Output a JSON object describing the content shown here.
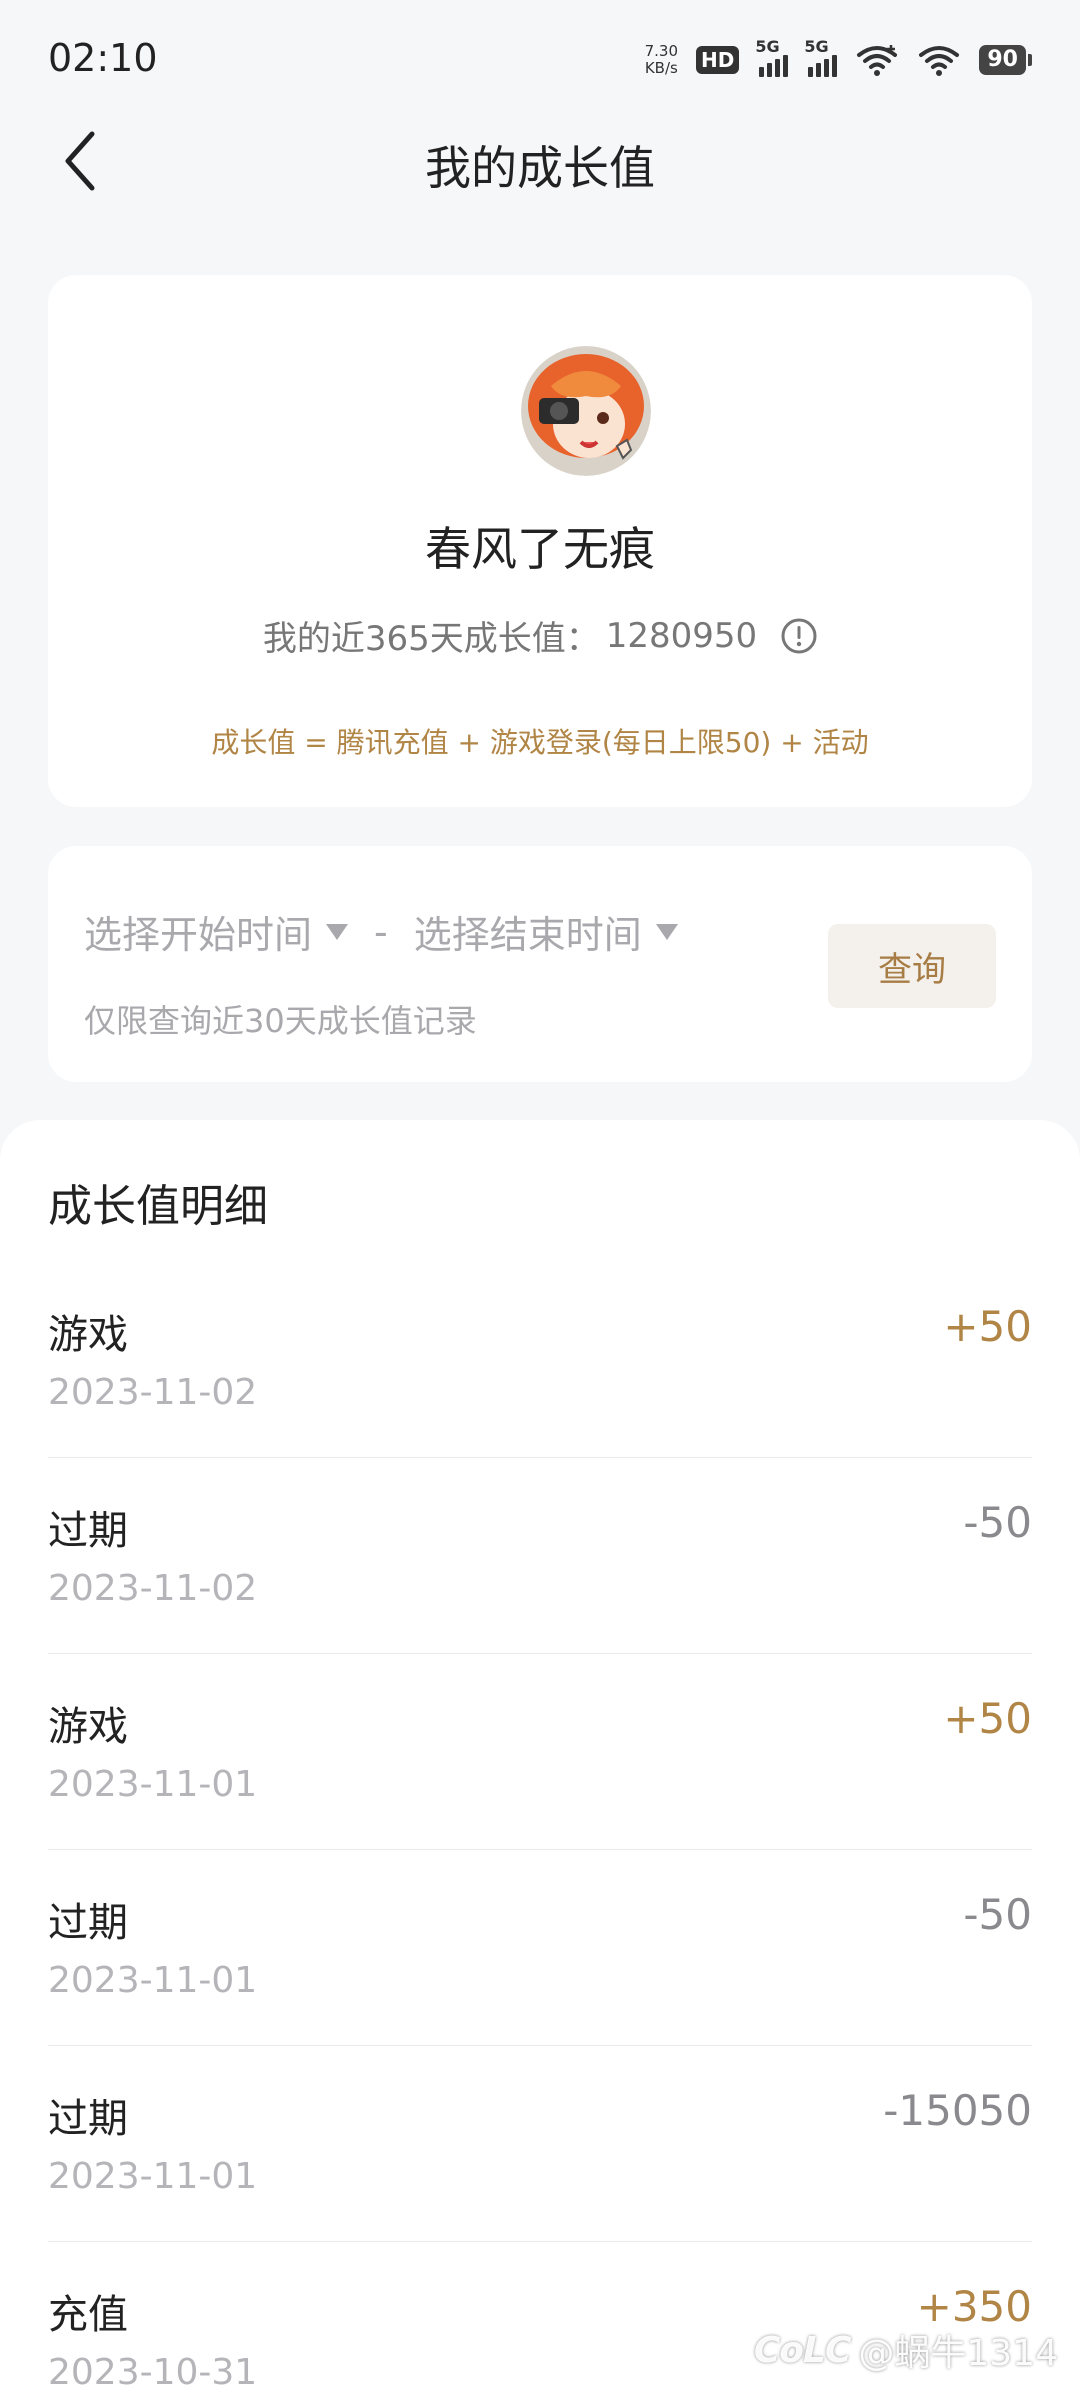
{
  "status_bar": {
    "time": "02:10",
    "net_speed_value": "7.30",
    "net_speed_unit": "KB/s",
    "hd_label": "HD",
    "sim1_tag": "5G",
    "sim2_tag": "5G",
    "battery_level": "90"
  },
  "header": {
    "title": "我的成长值"
  },
  "profile": {
    "nickname": "春风了无痕",
    "growth_label": "我的近365天成长值：",
    "growth_value": "1280950",
    "formula": "成长值 = 腾讯充值 + 游戏登录(每日上限50) + 活动"
  },
  "query": {
    "start_placeholder": "选择开始时间",
    "separator": "-",
    "end_placeholder": "选择结束时间",
    "hint": "仅限查询近30天成长值记录",
    "button_label": "查询"
  },
  "details": {
    "title": "成长值明细",
    "rows": [
      {
        "label": "游戏",
        "date": "2023-11-02",
        "amount": "+50",
        "positive": true
      },
      {
        "label": "过期",
        "date": "2023-11-02",
        "amount": "-50",
        "positive": false
      },
      {
        "label": "游戏",
        "date": "2023-11-01",
        "amount": "+50",
        "positive": true
      },
      {
        "label": "过期",
        "date": "2023-11-01",
        "amount": "-50",
        "positive": false
      },
      {
        "label": "过期",
        "date": "2023-11-01",
        "amount": "-15050",
        "positive": false
      },
      {
        "label": "充值",
        "date": "2023-10-31",
        "amount": "+350",
        "positive": true
      }
    ]
  },
  "watermark": {
    "logo": "CoLC",
    "text": "@蜗牛1314"
  },
  "colors": {
    "accent_gold": "#b08545",
    "negative_gray": "#8a8a8e",
    "background": "#f6f7f9"
  }
}
